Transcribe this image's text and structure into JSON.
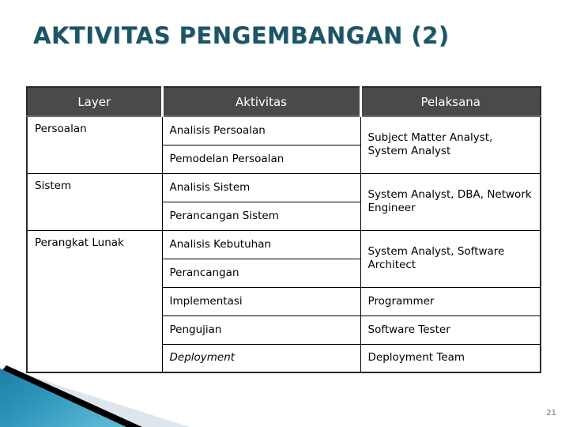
{
  "slide": {
    "title": "AKTIVITAS PENGEMBANGAN (2)",
    "page_number": "21",
    "title_color": "#1d5565",
    "header_bg_color": "#4a4a4a",
    "accent_blue": "#2e8fb5"
  },
  "table": {
    "headers": {
      "layer": "Layer",
      "aktivitas": "Aktivitas",
      "pelaksana": "Pelaksana"
    },
    "rows": [
      {
        "layer": "Persoalan",
        "layer_rowspan": 2,
        "activities": [
          {
            "name": "Analisis Persoalan",
            "italic": false
          },
          {
            "name": "Pemodelan Persoalan",
            "italic": false
          }
        ],
        "performer": "Subject Matter Analyst, System Analyst",
        "performer_rowspan": 2
      },
      {
        "layer": "Sistem",
        "layer_rowspan": 2,
        "activities": [
          {
            "name": "Analisis Sistem",
            "italic": false
          },
          {
            "name": "Perancangan Sistem",
            "italic": false
          }
        ],
        "performer": "System Analyst, DBA, Network Engineer",
        "performer_rowspan": 2
      },
      {
        "layer": "Perangkat Lunak",
        "layer_rowspan": 5,
        "activities": [
          {
            "name": "Analisis Kebutuhan",
            "italic": false
          },
          {
            "name": "Perancangan",
            "italic": false
          },
          {
            "name": "Implementasi",
            "italic": false
          },
          {
            "name": "Pengujian",
            "italic": false
          },
          {
            "name": "Deployment",
            "italic": true
          }
        ],
        "performers": [
          {
            "name": "System Analyst, Software Architect",
            "rowspan": 2
          },
          {
            "name": "Programmer",
            "rowspan": 1
          },
          {
            "name": "Software Tester",
            "rowspan": 1
          },
          {
            "name": "Deployment Team",
            "rowspan": 1
          }
        ]
      }
    ]
  }
}
